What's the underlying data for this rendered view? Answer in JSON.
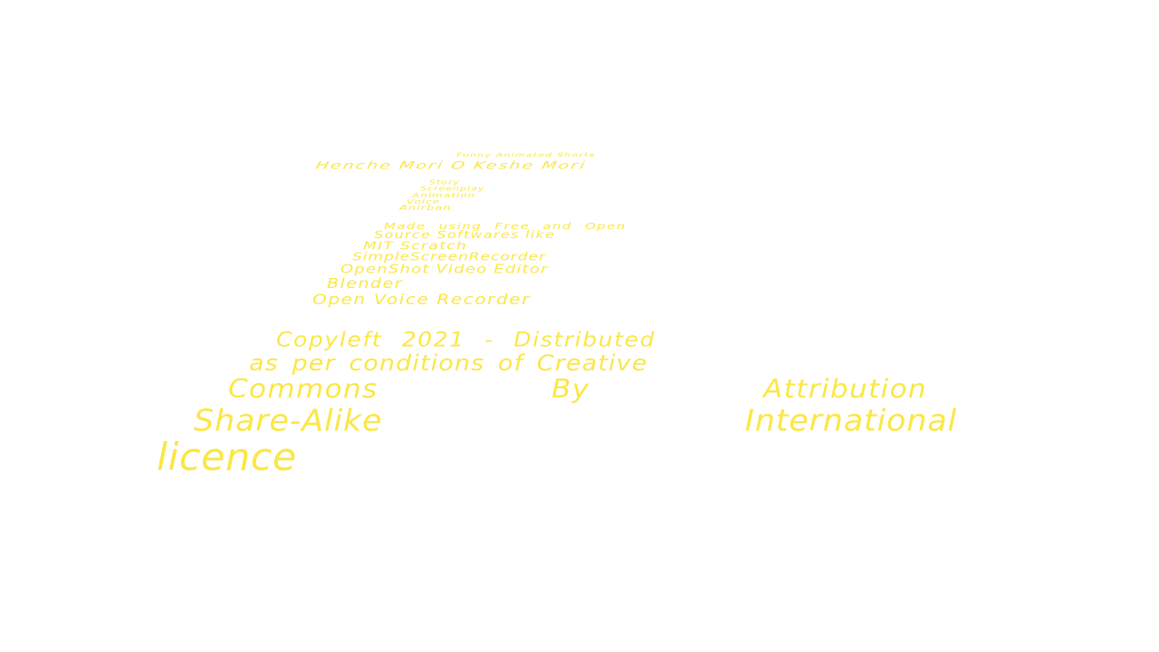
{
  "credits": {
    "series": "Funny Animated Shorts",
    "title": "Henche Mori O Keshe Mori",
    "roles": [
      "Story",
      "Screenplay",
      "Animation",
      "Voice"
    ],
    "author": "Anirban",
    "made_with": {
      "intro_line1": "Made using Free and Open",
      "intro_line2": "Source Softwares like",
      "tools": [
        "MIT Scratch",
        "SimpleScreenRecorder",
        "OpenShot Video Editor",
        "Blender",
        "Open Voice Recorder"
      ]
    },
    "license": {
      "line1": "Copyleft 2021 - Distributed",
      "line2": "as per conditions of Creative",
      "line3_words": [
        "Commons",
        "By",
        "Attribution"
      ],
      "line4_words": [
        "Share-Alike",
        "International"
      ],
      "line5": "licence"
    },
    "text_color": "#fbe745"
  }
}
